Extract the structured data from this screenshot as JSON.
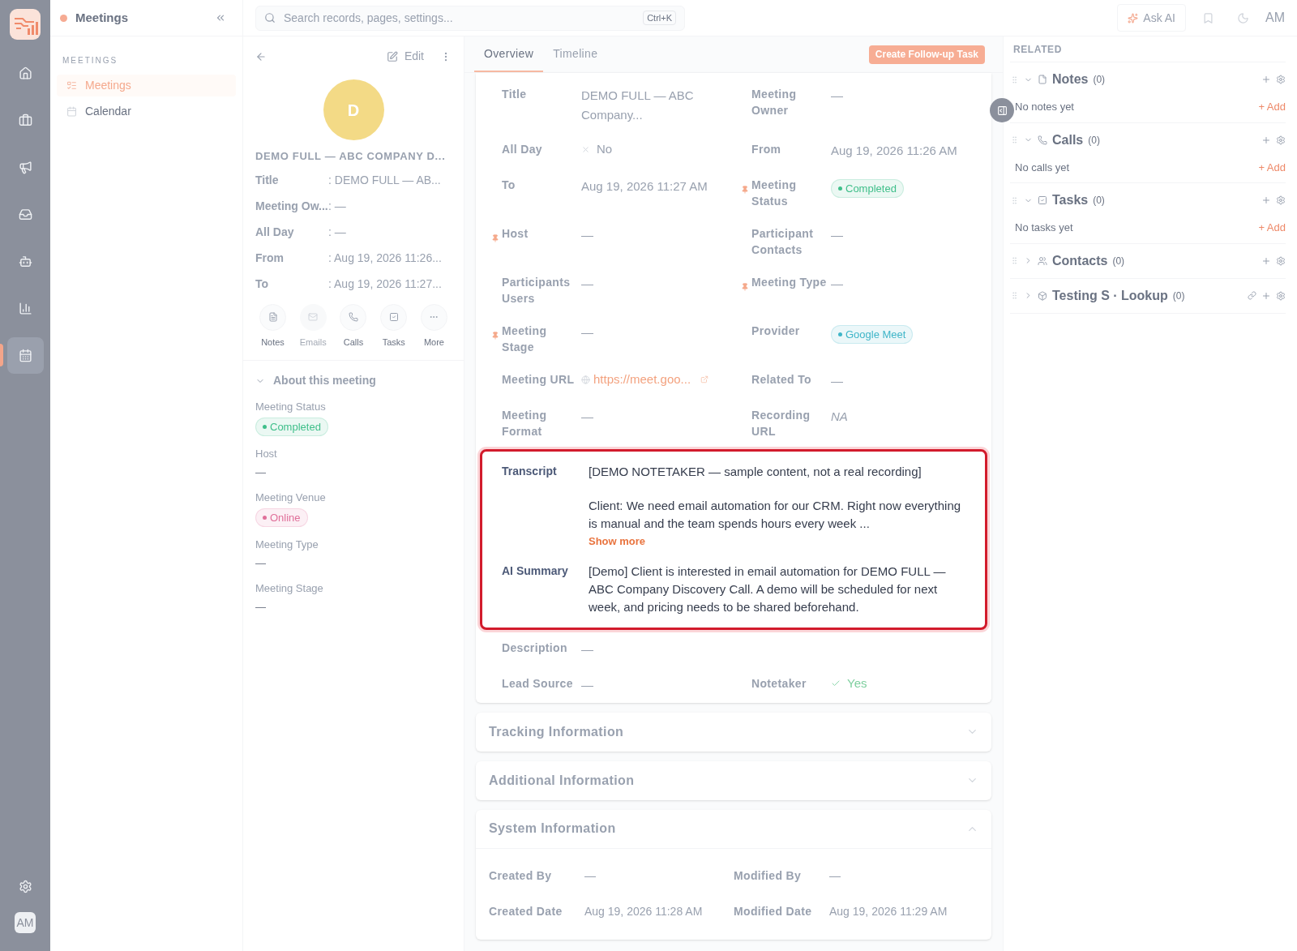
{
  "rail": {
    "items": [
      {
        "kind": "home",
        "selected": false
      },
      {
        "kind": "briefcase",
        "selected": false
      },
      {
        "kind": "megaphone",
        "selected": false
      },
      {
        "kind": "inbox",
        "selected": false
      },
      {
        "kind": "bot",
        "selected": false
      },
      {
        "kind": "chart",
        "selected": false
      },
      {
        "kind": "calendar",
        "selected": true
      }
    ],
    "avatar": "AM"
  },
  "nav": {
    "title": "Meetings",
    "section": "MEETINGS",
    "items": [
      {
        "label": "Meetings",
        "kind": "list",
        "selected": true
      },
      {
        "label": "Calendar",
        "kind": "calendar",
        "selected": false
      }
    ]
  },
  "topbar": {
    "search_placeholder": "Search records, pages, settings...",
    "shortcut": "Ctrl+K",
    "ask_ai": "Ask AI",
    "user": "AM"
  },
  "record": {
    "edit": "Edit",
    "avatar_letter": "D",
    "name": "DEMO FULL — ABC COMPANY D...",
    "fields": [
      {
        "label": "Title",
        "value": ": DEMO FULL — AB..."
      },
      {
        "label": "Meeting Ow...",
        "value": ": —"
      },
      {
        "label": "All Day",
        "value": ": —"
      },
      {
        "label": "From",
        "value": ": Aug 19, 2026 11:26..."
      },
      {
        "label": "To",
        "value": ": Aug 19, 2026 11:27..."
      }
    ],
    "actions": [
      {
        "kind": "notes",
        "label": "Notes",
        "disabled": false
      },
      {
        "kind": "emails",
        "label": "Emails",
        "disabled": true
      },
      {
        "kind": "calls",
        "label": "Calls",
        "disabled": false
      },
      {
        "kind": "tasks",
        "label": "Tasks",
        "disabled": false
      },
      {
        "kind": "more",
        "label": "More",
        "disabled": false
      }
    ],
    "about": {
      "title": "About this meeting",
      "expanded": true,
      "fields": [
        {
          "label": "Meeting Status",
          "kind": "badge",
          "value": "Completed",
          "color": "#3fbf8a"
        },
        {
          "label": "Host",
          "kind": "text",
          "value": "—"
        },
        {
          "label": "Meeting Venue",
          "kind": "badge",
          "value": "Online",
          "color": "#e0709a"
        },
        {
          "label": "Meeting Type",
          "kind": "text",
          "value": "—"
        },
        {
          "label": "Meeting Stage",
          "kind": "text",
          "value": "—"
        }
      ]
    }
  },
  "tabs": [
    {
      "label": "Overview",
      "selected": true
    },
    {
      "label": "Timeline",
      "selected": false
    }
  ],
  "follow_up_button": "Create Follow-up Task",
  "details": {
    "rows": [
      [
        {
          "label": "Title",
          "kind": "text",
          "value": "DEMO FULL — ABC Company...",
          "pinned": false
        },
        {
          "label": "Meeting Owner",
          "kind": "text",
          "value": "—",
          "pinned": false
        }
      ],
      [
        {
          "label": "All Day",
          "kind": "no",
          "value": "No",
          "pinned": false
        },
        {
          "label": "From",
          "kind": "text",
          "value": "Aug 19, 2026 11:26 AM",
          "pinned": false
        }
      ],
      [
        {
          "label": "To",
          "kind": "text",
          "value": "Aug 19, 2026 11:27 AM",
          "pinned": false
        },
        {
          "label": "Meeting Status",
          "kind": "badge",
          "value": "Completed",
          "color": "#3fbf8a",
          "pinned": true
        }
      ],
      [
        {
          "label": "Host",
          "kind": "text",
          "value": "—",
          "pinned": true
        },
        {
          "label": "Participant Contacts",
          "kind": "text",
          "value": "—",
          "pinned": false
        }
      ],
      [
        {
          "label": "Participants Users",
          "kind": "text",
          "value": "—",
          "pinned": false
        },
        {
          "label": "Meeting Type",
          "kind": "text",
          "value": "—",
          "pinned": true
        }
      ],
      [
        {
          "label": "Meeting Stage",
          "kind": "text",
          "value": "—",
          "pinned": true
        },
        {
          "label": "Provider",
          "kind": "badge",
          "value": "Google Meet",
          "color": "#3fb5c8",
          "pinned": false
        }
      ],
      [
        {
          "label": "Meeting URL",
          "kind": "link",
          "value": "https://meet.goo...",
          "pinned": false
        },
        {
          "label": "Related To",
          "kind": "text",
          "value": "—",
          "pinned": false
        }
      ],
      [
        {
          "label": "Meeting Format",
          "kind": "text",
          "value": "—",
          "pinned": false
        },
        {
          "label": "Recording URL",
          "kind": "italic",
          "value": "NA",
          "pinned": false
        }
      ]
    ],
    "highlight": {
      "transcript": {
        "label": "Transcript",
        "paragraphs": [
          "[DEMO NOTETAKER — sample content, not a real recording]",
          "Client: We need email automation for our CRM. Right now everything is manual and the team spends hours every week ..."
        ],
        "show_more": "Show more"
      },
      "summary": {
        "label": "AI Summary",
        "text": "[Demo] Client is interested in email automation for DEMO FULL — ABC Company Discovery Call. A demo will be scheduled for next week, and pricing needs to be shared beforehand."
      }
    },
    "rows_after": [
      [
        {
          "label": "Description",
          "kind": "text",
          "value": "—",
          "pinned": false
        }
      ],
      [
        {
          "label": "Lead Source",
          "kind": "text",
          "value": "—",
          "pinned": false
        },
        {
          "label": "Notetaker",
          "kind": "yes",
          "value": "Yes",
          "pinned": false
        }
      ]
    ]
  },
  "sections": [
    {
      "title": "Tracking Information",
      "expanded": false
    },
    {
      "title": "Additional Information",
      "expanded": false
    },
    {
      "title": "System Information",
      "expanded": true,
      "rows": [
        [
          {
            "label": "Created By",
            "value": "—"
          },
          {
            "label": "Modified By",
            "value": "—"
          }
        ],
        [
          {
            "label": "Created Date",
            "value": "Aug 19, 2026 11:28 AM"
          },
          {
            "label": "Modified Date",
            "value": "Aug 19, 2026 11:29 AM"
          }
        ]
      ]
    }
  ],
  "related": {
    "title": "RELATED",
    "groups": [
      {
        "kind": "notes",
        "name": "Notes",
        "count": "(0)",
        "expanded": true,
        "empty": "No notes yet",
        "add": "+ Add",
        "linkable": false
      },
      {
        "kind": "calls",
        "name": "Calls",
        "count": "(0)",
        "expanded": true,
        "empty": "No calls yet",
        "add": "+ Add",
        "linkable": false
      },
      {
        "kind": "tasks",
        "name": "Tasks",
        "count": "(0)",
        "expanded": true,
        "empty": "No tasks yet",
        "add": "+ Add",
        "linkable": false
      },
      {
        "kind": "contacts",
        "name": "Contacts",
        "count": "(0)",
        "expanded": false,
        "linkable": false
      },
      {
        "kind": "lookup",
        "name": "Testing S · Lookup",
        "count": "(0)",
        "expanded": false,
        "linkable": true
      }
    ]
  }
}
